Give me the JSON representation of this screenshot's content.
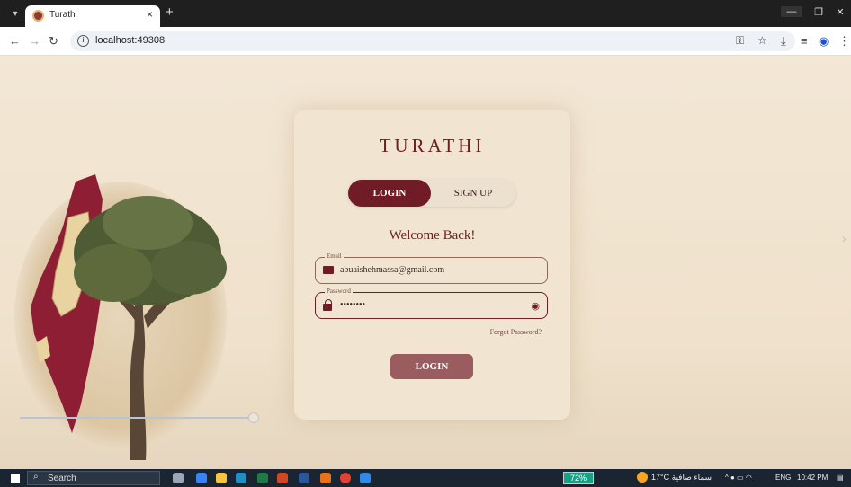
{
  "browser": {
    "tab_title": "Turathi",
    "tab_close": "×",
    "new_tab": "+",
    "url": "localhost:49308"
  },
  "app": {
    "brand": "TURATHI",
    "tabs": {
      "login": "LOGIN",
      "signup": "SIGN UP"
    },
    "welcome": "Welcome Back!",
    "email": {
      "label": "Email",
      "value": "abuaishehmassa@gmail.com"
    },
    "password": {
      "label": "Password",
      "value": "••••••••"
    },
    "forgot": "Forgot Password?",
    "submit": "LOGIN"
  },
  "taskbar": {
    "search": "Search",
    "battery": "72%",
    "weather": "17°C سماء صافية",
    "language": "ENG",
    "time": "10:42 PM"
  },
  "colors": {
    "primary": "#6f1c26",
    "button": "#9b5c5f",
    "background": "#f1e6d6"
  }
}
